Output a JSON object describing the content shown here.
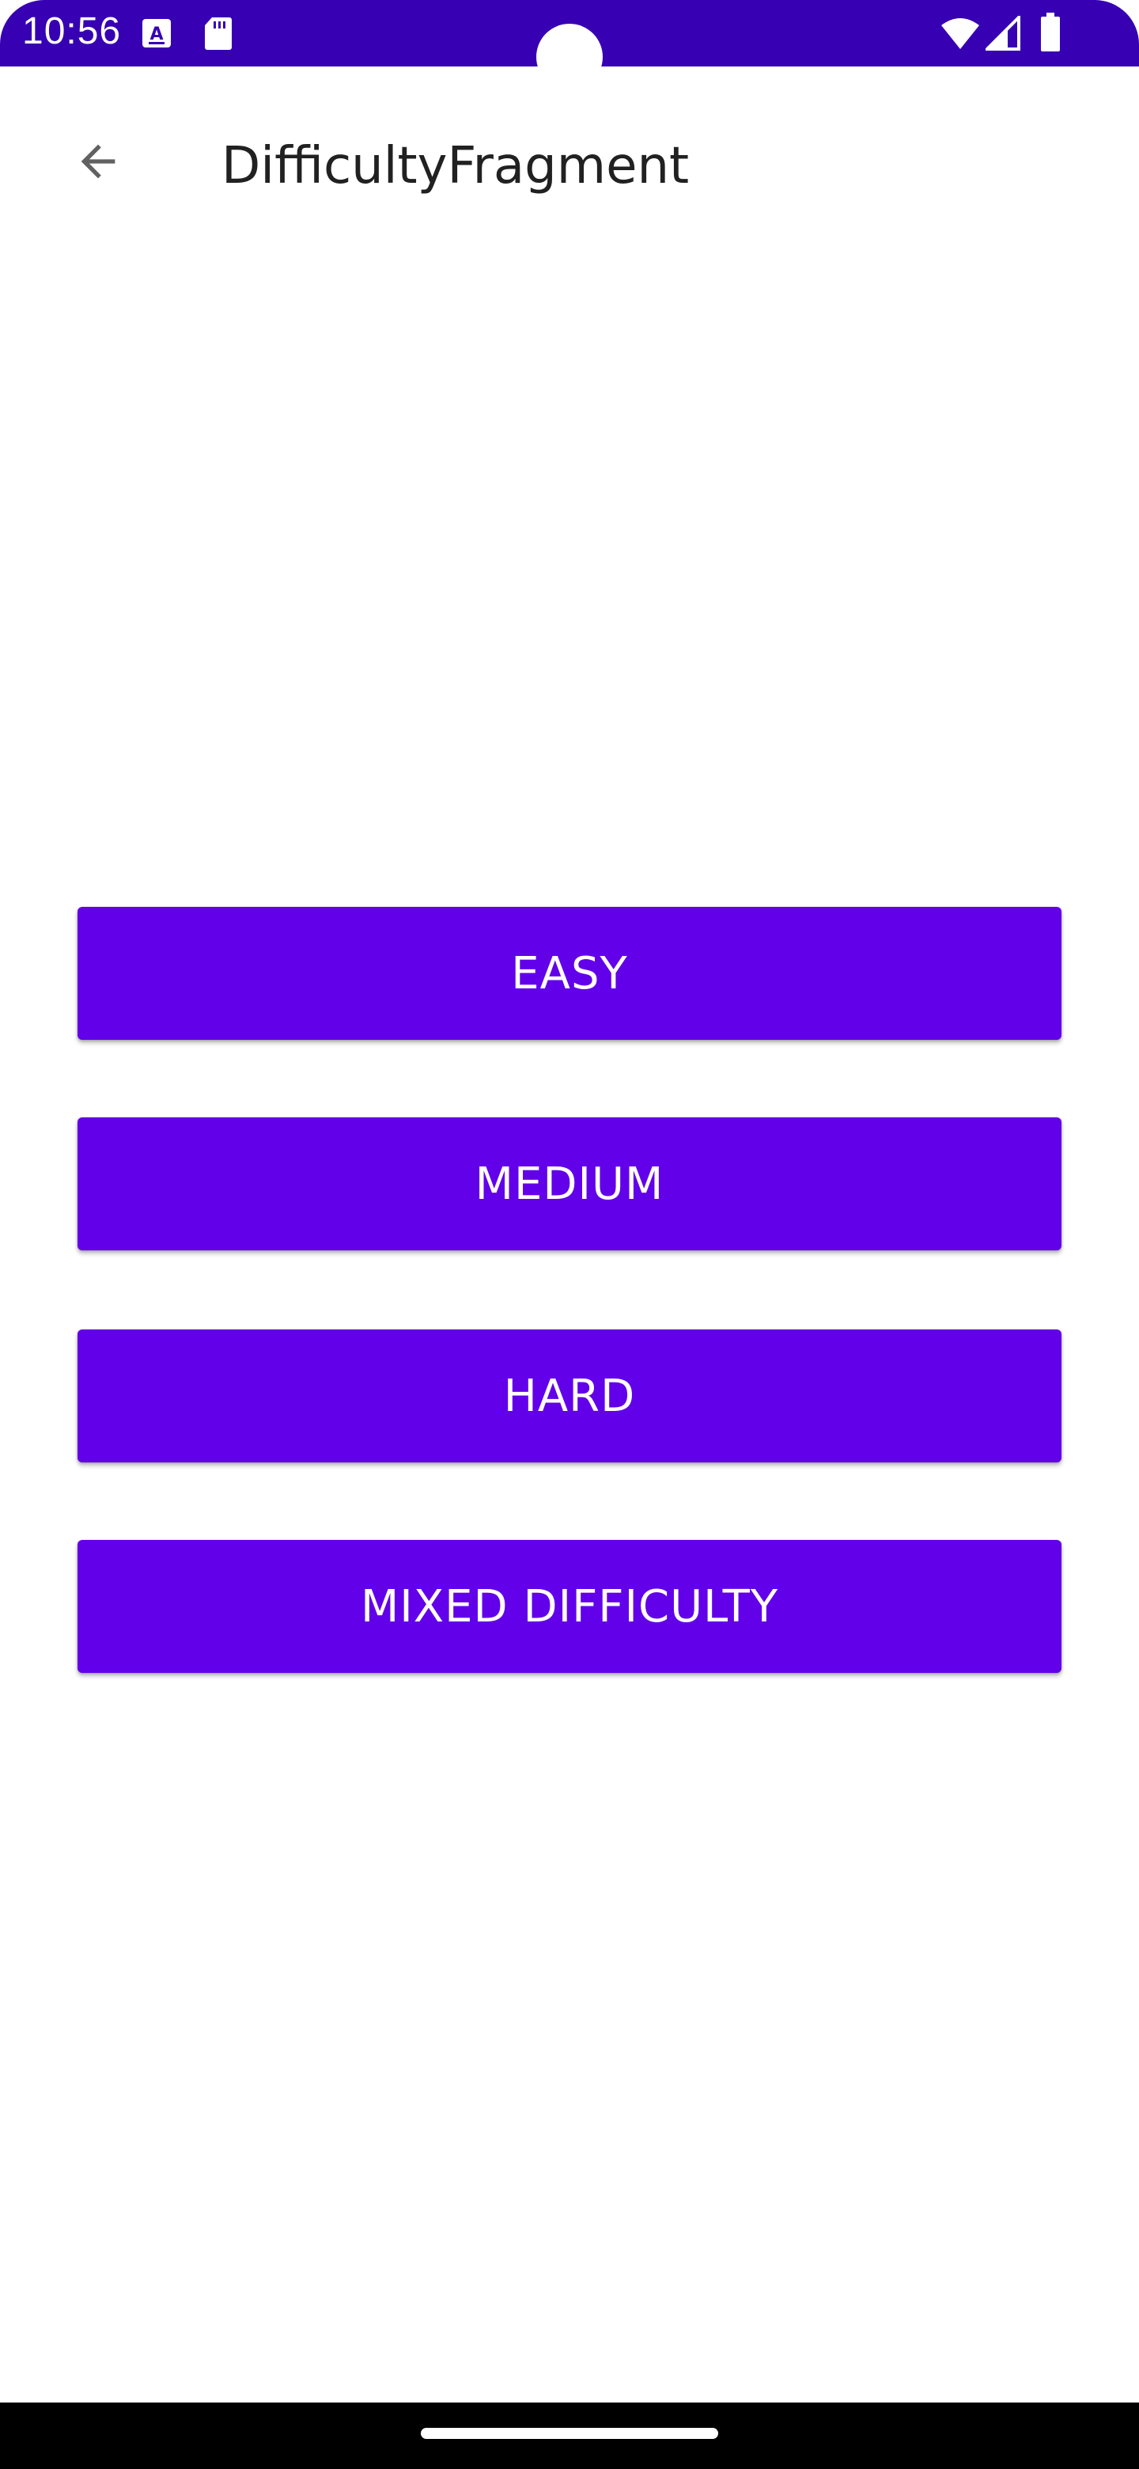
{
  "status_bar": {
    "time": "10:56",
    "icons": [
      "font-a-icon",
      "sd-card-icon",
      "wifi-icon",
      "cell-signal-icon",
      "battery-icon"
    ],
    "background_color": "#3700b3"
  },
  "app_bar": {
    "title": "DifficultyFragment",
    "back_icon": "arrow-back-icon"
  },
  "buttons": {
    "easy": "EASY",
    "medium": "MEDIUM",
    "hard": "HARD",
    "mixed": "MIXED DIFFICULTY"
  },
  "colors": {
    "accent": "#6200ea",
    "status": "#3700b3"
  }
}
